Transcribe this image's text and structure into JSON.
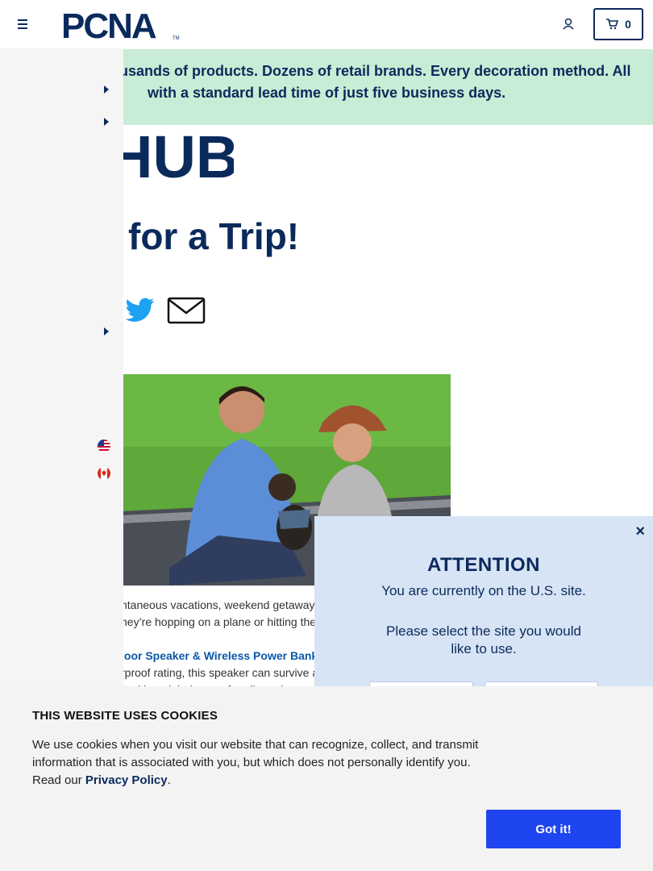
{
  "header": {
    "logo_text": "PCNA",
    "logo_mark": "TM",
    "cart_count": "0"
  },
  "banner": {
    "line1": "usands of products. Dozens of retail brands. Every decoration method. All",
    "line2": "with a standard lead time of just five business days."
  },
  "article": {
    "hub_text": "HUB",
    "title": "for a Trip!",
    "para1": "ntaneous vacations, weekend getaway",
    "para2": "ney’re hopping on a plane or hitting the",
    "product_link": "loor Speaker & Wireless Power Bank",
    "para3": "rproof rating, this speaker can survive a",
    "para4": "it with a eight hours of audio and"
  },
  "modal": {
    "close": "×",
    "title": "ATTENTION",
    "subtitle": "You are currently on the U.S. site.",
    "prompt": "Please select the site you would like to use."
  },
  "cookie": {
    "title": "THIS WEBSITE USES COOKIES",
    "text": "We use cookies when you visit our website that can recognize, collect, and transmit information that is associated with you, but which does not personally identify you. Read our ",
    "link": "Privacy Policy",
    "end": ".",
    "button": "Got it!"
  },
  "colors": {
    "brand": "#0b2a5c",
    "banner_bg": "#c8ecd5",
    "cookie_button": "#1f45f0",
    "modal_bg": "#d7e4f5"
  }
}
